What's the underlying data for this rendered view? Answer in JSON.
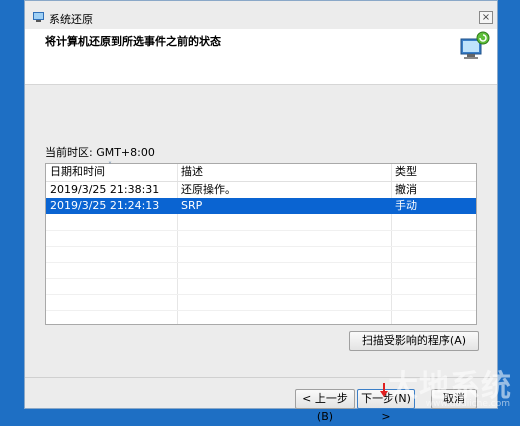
{
  "window": {
    "title": "系统还原",
    "close_label": "×"
  },
  "header": {
    "heading": "将计算机还原到所选事件之前的状态"
  },
  "timezone_label": "当前时区: GMT+8:00",
  "table": {
    "columns": [
      "日期和时间",
      "描述",
      "类型"
    ],
    "rows": [
      {
        "date": "2019/3/25 21:38:31",
        "desc": "还原操作。",
        "type": "撤消",
        "selected": false
      },
      {
        "date": "2019/3/25 21:24:13",
        "desc": "SRP",
        "type": "手动",
        "selected": true
      }
    ]
  },
  "buttons": {
    "scan": "扫描受影响的程序(A)",
    "prev": "< 上一步(B)",
    "next": "下一步(N) >",
    "cancel": "取消"
  },
  "watermark": {
    "text": "大地系统",
    "sub": "www.dadiiche.com"
  },
  "colors": {
    "selection": "#0a64d2",
    "desktop": "#1e6fc4"
  }
}
